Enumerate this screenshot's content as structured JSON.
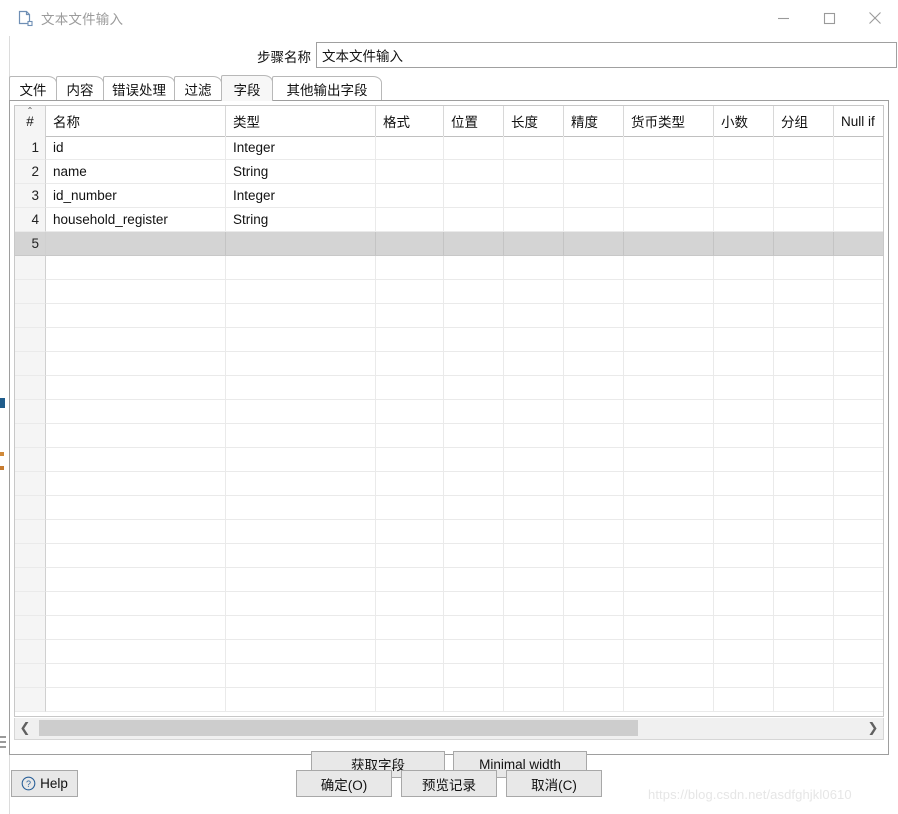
{
  "window": {
    "title": "文本文件输入",
    "icon": "file-document-icon",
    "controls": {
      "minimize": "minimize-icon",
      "maximize": "maximize-icon",
      "close": "close-icon"
    }
  },
  "step_name": {
    "label": "步骤名称",
    "value": "文本文件输入",
    "placeholder": ""
  },
  "tabs": [
    {
      "label": "文件",
      "selected": false
    },
    {
      "label": "内容",
      "selected": false
    },
    {
      "label": "错误处理",
      "selected": false
    },
    {
      "label": "过滤",
      "selected": false
    },
    {
      "label": "字段",
      "selected": true
    },
    {
      "label": "其他输出字段",
      "selected": false
    }
  ],
  "table": {
    "sort_indicator": "ascending",
    "columns": [
      "#",
      "名称",
      "类型",
      "格式",
      "位置",
      "长度",
      "精度",
      "货币类型",
      "小数",
      "分组",
      "Null if"
    ],
    "rows": [
      {
        "num": "1",
        "名称": "id",
        "类型": "Integer",
        "格式": "",
        "位置": "",
        "长度": "",
        "精度": "",
        "货币类型": "",
        "小数": "",
        "分组": "",
        "Null if": "",
        "selected": false
      },
      {
        "num": "2",
        "名称": "name",
        "类型": "String",
        "格式": "",
        "位置": "",
        "长度": "",
        "精度": "",
        "货币类型": "",
        "小数": "",
        "分组": "",
        "Null if": "",
        "selected": false
      },
      {
        "num": "3",
        "名称": "id_number",
        "类型": "Integer",
        "格式": "",
        "位置": "",
        "长度": "",
        "精度": "",
        "货币类型": "",
        "小数": "",
        "分组": "",
        "Null if": "",
        "selected": false
      },
      {
        "num": "4",
        "名称": "household_register",
        "类型": "String",
        "格式": "",
        "位置": "",
        "长度": "",
        "精度": "",
        "货币类型": "",
        "小数": "",
        "分组": "",
        "Null if": "",
        "selected": false
      },
      {
        "num": "5",
        "名称": "",
        "类型": "",
        "格式": "",
        "位置": "",
        "长度": "",
        "精度": "",
        "货币类型": "",
        "小数": "",
        "分组": "",
        "Null if": "",
        "selected": true
      }
    ]
  },
  "scrollbar": {
    "left_arrow": "chevron-left-icon",
    "right_arrow": "chevron-right-icon",
    "thumb_fraction": 0.73
  },
  "mid_buttons": {
    "get_fields": "获取字段",
    "minimal_width": "Minimal width"
  },
  "bottom_buttons": {
    "help": "Help",
    "ok": "确定(O)",
    "preview": "预览记录",
    "cancel": "取消(C)"
  },
  "watermark": "https://blog.csdn.net/asdfghjkl0610",
  "colors": {
    "selected_row": "#d4d4d4",
    "gutter": "#f5f5f5",
    "button_face": "#e8e8e8",
    "panel_border": "#9e9e9e",
    "title_text": "#9b9b9b",
    "help_icon": "#2a6099"
  }
}
